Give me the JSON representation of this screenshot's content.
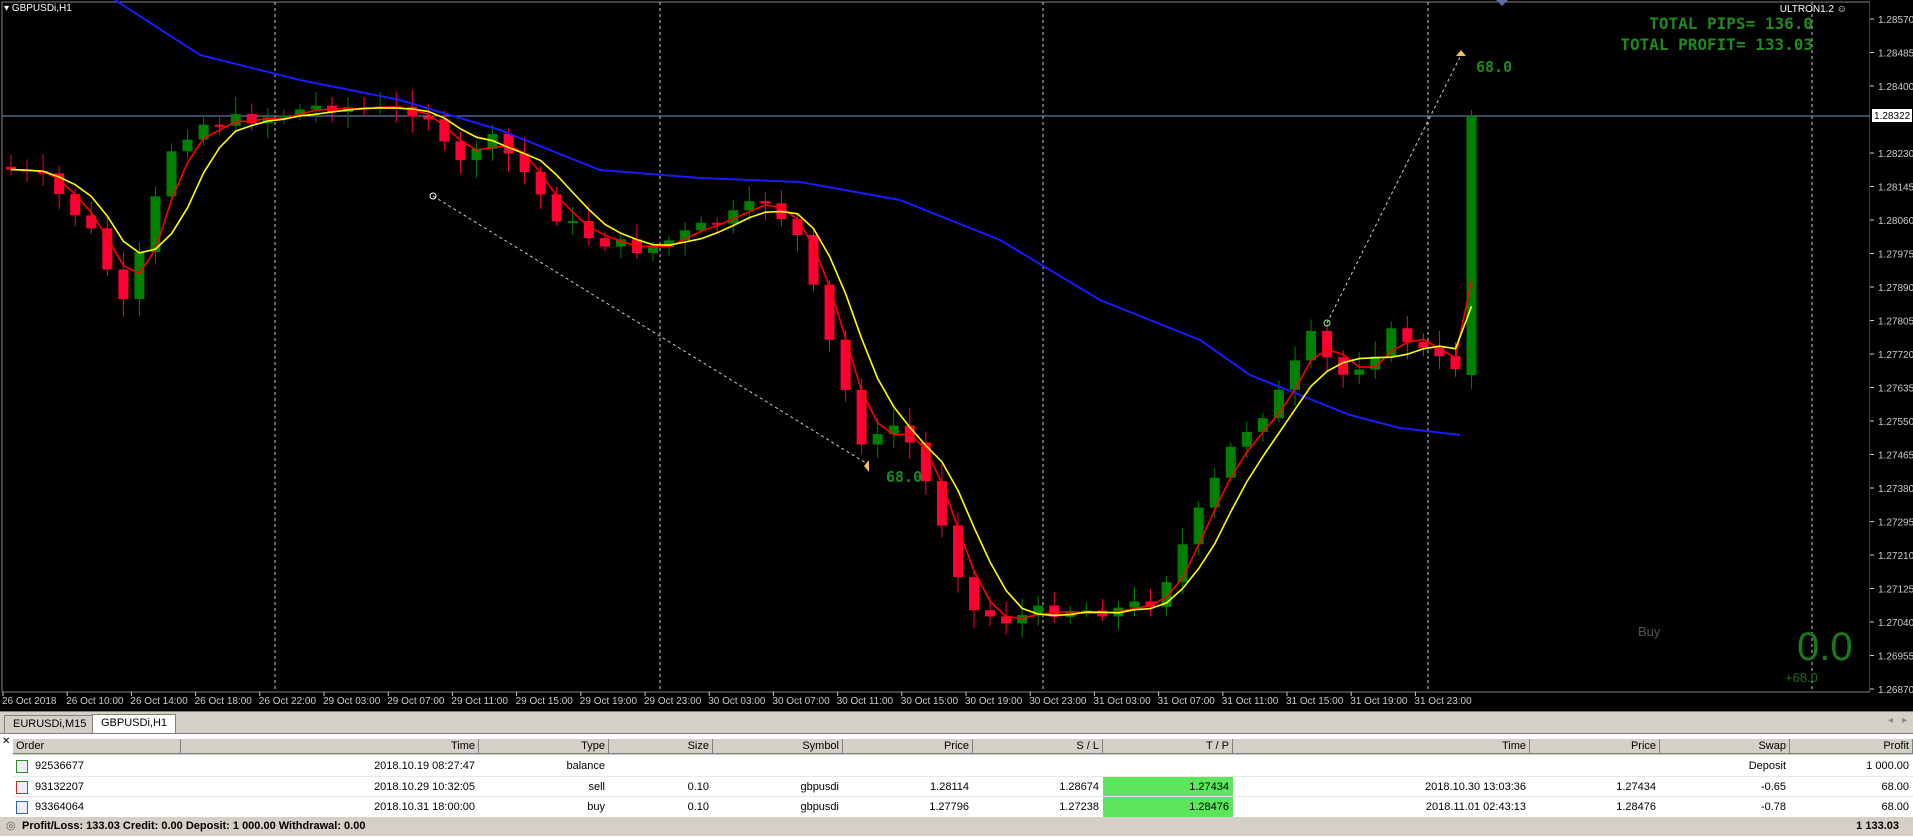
{
  "window": {
    "title": "GBPUSDi,H1",
    "ea_name": "ULTRON1.2"
  },
  "overlay": {
    "total_pips": "TOTAL PIPS= 136.0",
    "total_profit": "TOTAL PROFIT= 133.03",
    "annotation_right": "68.0",
    "annotation_left": "68.0",
    "big_value": "0.0",
    "small_value": "+68.0",
    "ghost_label": "Buy"
  },
  "colors": {
    "bull": "#008000",
    "bear": "#ff0033",
    "ma_blue": "#1a1aff",
    "ma_red": "#ff0000",
    "ma_yellow": "#ffff00"
  },
  "price_axis": {
    "labels": [
      "1.28570",
      "1.28485",
      "1.28400",
      "1.28230",
      "1.28145",
      "1.28060",
      "1.27975",
      "1.27890",
      "1.27805",
      "1.27720",
      "1.27635",
      "1.27550",
      "1.27465",
      "1.27380",
      "1.27295",
      "1.27210",
      "1.27125",
      "1.27040",
      "1.26955",
      "1.26870"
    ],
    "current": "1.28322"
  },
  "time_axis": {
    "labels": [
      "26 Oct 2018",
      "26 Oct 10:00",
      "26 Oct 14:00",
      "26 Oct 18:00",
      "26 Oct 22:00",
      "29 Oct 03:00",
      "29 Oct 07:00",
      "29 Oct 11:00",
      "29 Oct 15:00",
      "29 Oct 19:00",
      "29 Oct 23:00",
      "30 Oct 03:00",
      "30 Oct 07:00",
      "30 Oct 11:00",
      "30 Oct 15:00",
      "30 Oct 19:00",
      "30 Oct 23:00",
      "31 Oct 03:00",
      "31 Oct 07:00",
      "31 Oct 11:00",
      "31 Oct 15:00",
      "31 Oct 19:00",
      "31 Oct 23:00"
    ]
  },
  "tabs": [
    {
      "label": "EURUSDi,M15"
    },
    {
      "label": "GBPUSDi,H1"
    }
  ],
  "terminal": {
    "columns": [
      "Order",
      "Time",
      "Type",
      "Size",
      "Symbol",
      "Price",
      "S / L",
      "T / P",
      "Time",
      "Price",
      "Swap",
      "Profit"
    ],
    "rows": [
      {
        "order": "92536677",
        "time": "2018.10.19 08:27:47",
        "type": "balance",
        "size": "",
        "symbol": "",
        "price": "",
        "sl": "",
        "tp": "",
        "close_time": "",
        "close_price": "",
        "swap": "Deposit",
        "profit": "1 000.00"
      },
      {
        "order": "93132207",
        "time": "2018.10.29 10:32:05",
        "type": "sell",
        "size": "0.10",
        "symbol": "gbpusdi",
        "price": "1.28114",
        "sl": "1.28674",
        "tp": "1.27434",
        "close_time": "2018.10.30 13:03:36",
        "close_price": "1.27434",
        "swap": "-0.65",
        "profit": "68.00"
      },
      {
        "order": "93364064",
        "time": "2018.10.31 18:00:00",
        "type": "buy",
        "size": "0.10",
        "symbol": "gbpusdi",
        "price": "1.27796",
        "sl": "1.27238",
        "tp": "1.28476",
        "close_time": "2018.11.01 02:43:13",
        "close_price": "1.28476",
        "swap": "-0.78",
        "profit": "68.00"
      }
    ],
    "footer": "Profit/Loss: 133.03  Credit: 0.00  Deposit: 1 000.00  Withdrawal: 0.00",
    "footer_total": "1 133.03"
  }
}
